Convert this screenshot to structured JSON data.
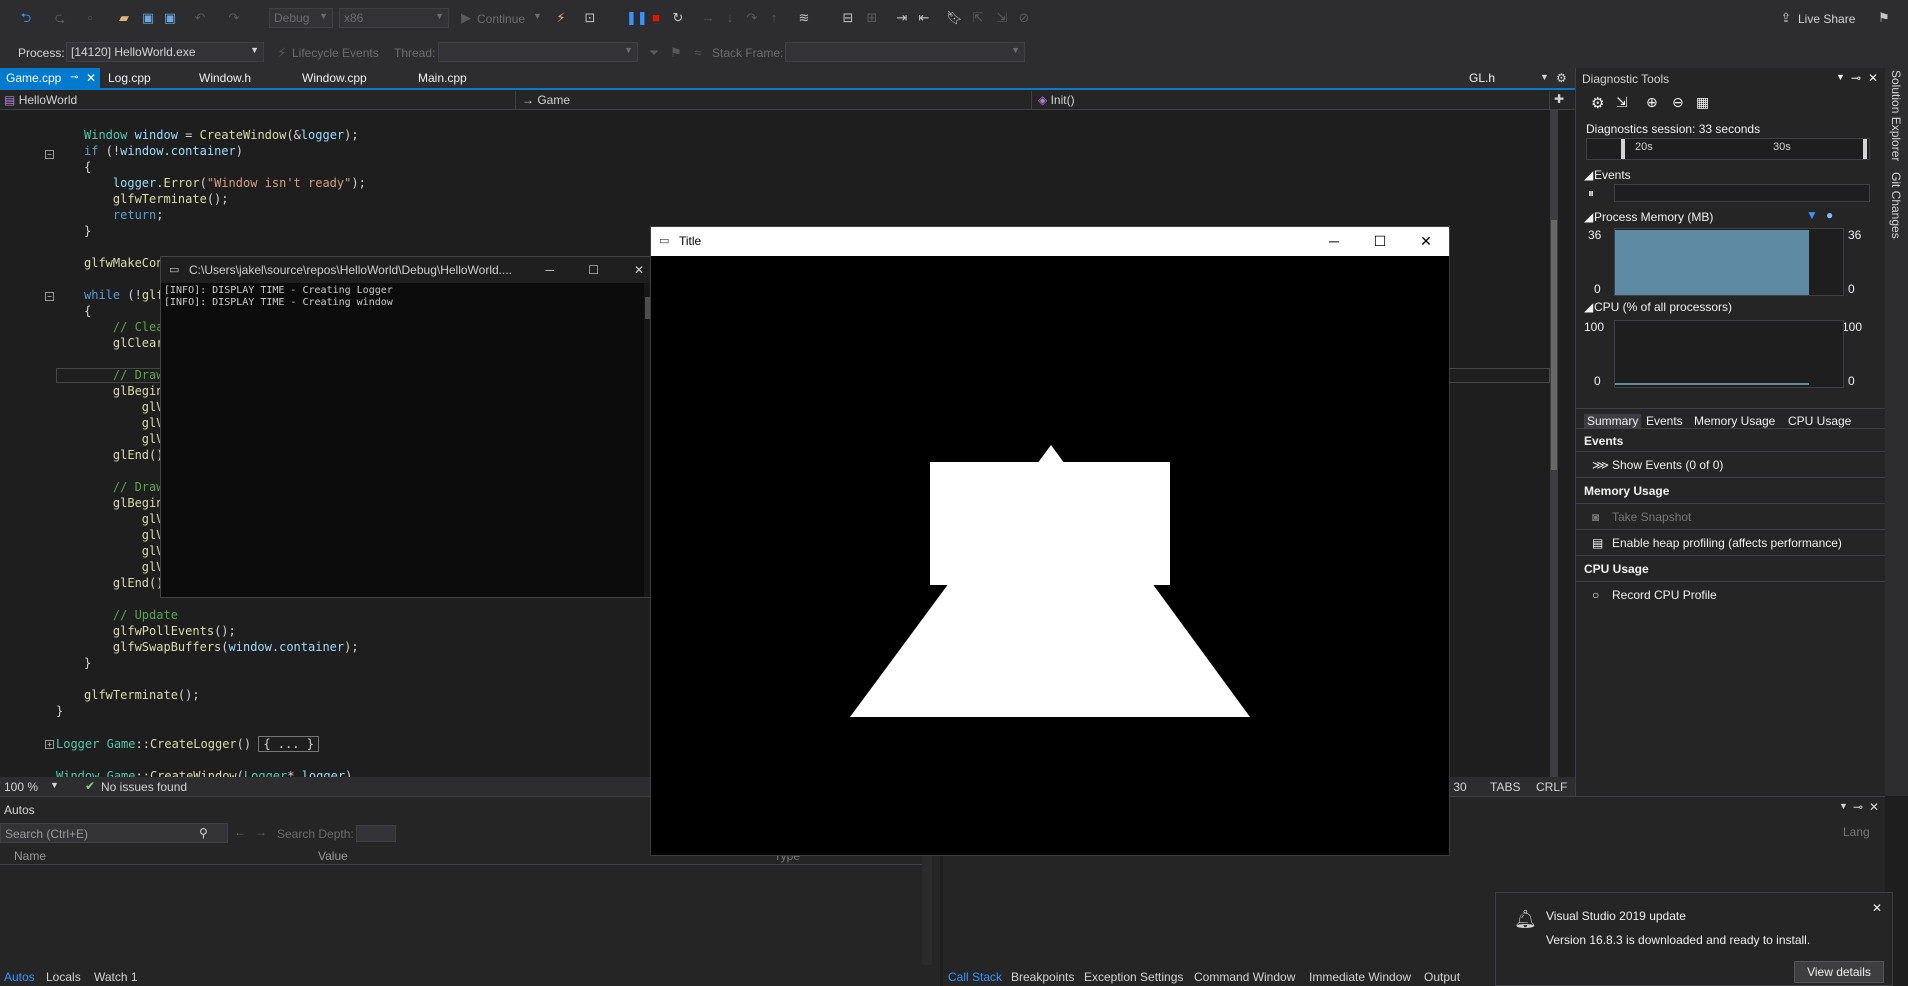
{
  "toolbar": {
    "config": "Debug",
    "platform": "x86",
    "continue_label": "Continue",
    "live_share_label": "Live Share",
    "process_label": "Process:",
    "process_value": "[14120] HelloWorld.exe",
    "lifecycle_label": "Lifecycle Events",
    "thread_label": "Thread:",
    "stack_frame_label": "Stack Frame:"
  },
  "tabs": [
    {
      "label": "Game.cpp"
    },
    {
      "label": "Log.cpp"
    },
    {
      "label": "Window.h"
    },
    {
      "label": "Window.cpp"
    },
    {
      "label": "Main.cpp"
    },
    {
      "label": "GL.h"
    }
  ],
  "nav": {
    "project": "HelloWorld",
    "scope": "Game",
    "member": "Init()"
  },
  "code_lines": [
    "Window window = CreateWindow(&logger);",
    "if (!window.container)",
    "{",
    "    logger.Error(\"Window isn't ready\");",
    "    glfwTerminate();",
    "    return;",
    "}",
    "glfwMakeCon",
    "while (!glf",
    "{",
    "    // Clea",
    "    glClear",
    "    // Draw",
    "    glBegin",
    "        glV",
    "        glV",
    "        glV",
    "    glEnd()",
    "    // Draw",
    "    glBegin",
    "        glV",
    "        glV",
    "        glV",
    "        glV",
    "    glEnd()",
    "    // Update",
    "    glfwPollEvents();",
    "    glfwSwapBuffers(window.container);",
    "}",
    "glfwTerminate();",
    "}",
    "Logger Game::CreateLogger()",
    "{ ... }",
    "Window Game::CreateWindow(Logger* logger)"
  ],
  "editor_status": {
    "zoom": "100 %",
    "issues": "No issues found",
    "col": "h: 30",
    "indent": "TABS",
    "eol": "CRLF"
  },
  "console": {
    "title": "C:\\Users\\jakel\\source\\repos\\HelloWorld\\Debug\\HelloWorld....",
    "lines": [
      "[INFO]: DISPLAY TIME - Creating Logger",
      "[INFO]: DISPLAY TIME - Creating window"
    ]
  },
  "glwindow": {
    "title": "Title"
  },
  "diag": {
    "title": "Diagnostic Tools",
    "session": "Diagnostics session: 33 seconds",
    "t1": "20s",
    "t2": "30s",
    "events_header": "Events",
    "memory_header": "Process Memory (MB)",
    "memory_max": "36",
    "memory_min": "0",
    "memory_level": 0.98,
    "cpu_header": "CPU (% of all processors)",
    "cpu_max": "100",
    "cpu_min": "0",
    "tabs": [
      "Summary",
      "Events",
      "Memory Usage",
      "CPU Usage"
    ],
    "sec_events": "Events",
    "show_events": "Show Events (0 of 0)",
    "sec_memory": "Memory Usage",
    "take_snapshot": "Take Snapshot",
    "heap_profiling": "Enable heap profiling (affects performance)",
    "sec_cpu": "CPU Usage",
    "record_cpu": "Record CPU Profile"
  },
  "side_tabs": [
    "Solution Explorer",
    "Git Changes"
  ],
  "autos": {
    "title": "Autos",
    "search_placeholder": "Search (Ctrl+E)",
    "search_depth": "Search Depth:",
    "col_name": "Name",
    "col_value": "Value",
    "col_type": "Type",
    "tabs": [
      "Autos",
      "Locals",
      "Watch 1"
    ]
  },
  "callstack": {
    "col_lang": "Lang",
    "tabs": [
      "Call Stack",
      "Breakpoints",
      "Exception Settings",
      "Command Window",
      "Immediate Window",
      "Output"
    ]
  },
  "notification": {
    "title": "Visual Studio 2019 update",
    "message": "Version 16.8.3 is downloaded and ready to install.",
    "button": "View details"
  },
  "colors": {
    "accent": "#007acc",
    "background": "#1e1e1e",
    "panel": "#252526",
    "chart_fill": "#5e8aa3"
  }
}
